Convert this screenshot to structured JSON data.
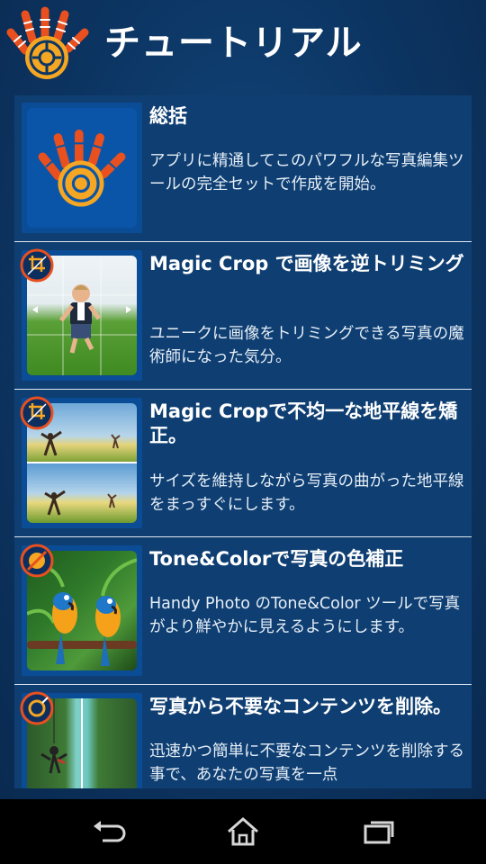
{
  "header": {
    "title": "チュートリアル",
    "logo_icon": "hand-photo-logo-icon"
  },
  "items": [
    {
      "title": "総括",
      "desc": "アプリに精通してこのパワフルな写真編集ツールの完全セットで作成を開始。",
      "thumb": "hand-logo"
    },
    {
      "title": "Magic Crop で画像を逆トリミング",
      "desc": "ユニークに画像をトリミングできる写真の魔術師になった気分。",
      "thumb": "child-running-in-grass",
      "badge_icon": "magic-crop-icon"
    },
    {
      "title": "Magic Cropで不均一な地平線を矯正。",
      "desc": "サイズを維持しながら写真の曲がった地平線をまっすぐにします。",
      "thumb": "horizon-field-photo",
      "badge_icon": "magic-crop-icon"
    },
    {
      "title": "Tone&Colorで写真の色補正",
      "desc": "Handy Photo のTone&Color ツールで写真がより鮮やかに見えるようにします。",
      "thumb": "parrots-photo",
      "badge_icon": "tone-color-icon"
    },
    {
      "title": "写真から不要なコンテンツを削除。",
      "desc": "迅速かつ簡単に不要なコンテンツを削除する事で、あなたの写真を一点",
      "thumb": "bungee-jump-photo",
      "badge_icon": "retouch-icon"
    }
  ],
  "navbar": {
    "back_icon": "back-icon",
    "home_icon": "home-icon",
    "recents_icon": "recent-apps-icon"
  },
  "colors": {
    "background": "#0c3563",
    "list_bg": "#0f3f72",
    "accent_orange": "#f07a22"
  }
}
